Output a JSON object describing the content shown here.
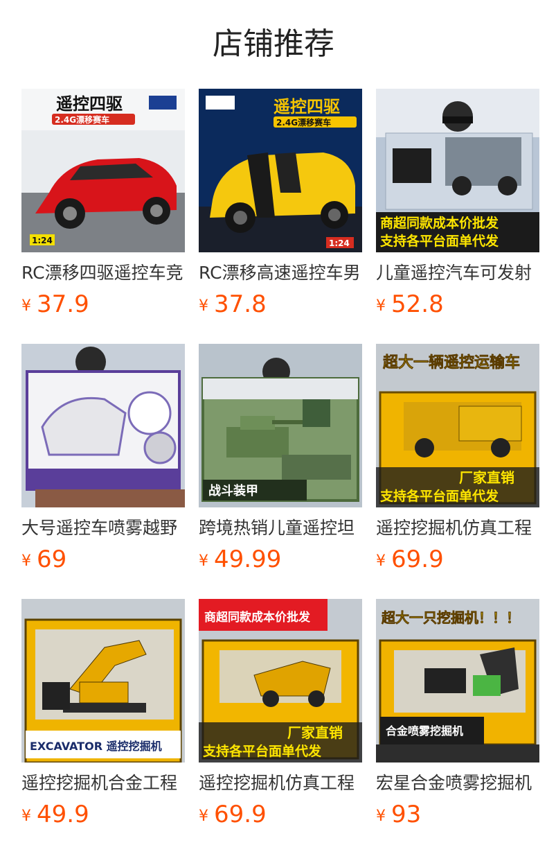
{
  "section": {
    "title": "店铺推荐"
  },
  "colors": {
    "price": "#ff5000",
    "title_text": "#333333",
    "heading": "#222222"
  },
  "products": [
    {
      "title": "RC漂移四驱遥控车竞",
      "currency": "¥",
      "price": "37.9",
      "image": {
        "icon": "red-sports-car-image",
        "banner": "遥控四驱",
        "sub_banner": "2.4G漂移赛车",
        "scale": "1:24"
      }
    },
    {
      "title": "RC漂移高速遥控车男",
      "currency": "¥",
      "price": "37.8",
      "image": {
        "icon": "yellow-muscle-car-image",
        "banner": "遥控四驱",
        "sub_banner": "2.4G漂移赛车",
        "scale": "1:24"
      }
    },
    {
      "title": "儿童遥控汽车可发射",
      "currency": "¥",
      "price": "52.8",
      "image": {
        "icon": "offroad-truck-box-image",
        "caption_line1": "商超同款成本价批发",
        "caption_line2": "支持各平台面单代发"
      }
    },
    {
      "title": "大号遥控车喷雾越野",
      "currency": "¥",
      "price": "69",
      "image": {
        "icon": "spray-offroad-car-box-image"
      }
    },
    {
      "title": "跨境热销儿童遥控坦",
      "currency": "¥",
      "price": "49.99",
      "image": {
        "icon": "rc-tank-box-image",
        "caption_line1": "战斗装甲"
      }
    },
    {
      "title": "遥控挖掘机仿真工程",
      "currency": "¥",
      "price": "69.9",
      "image": {
        "icon": "transport-truck-box-image",
        "banner": "超大一辆遥控运输车",
        "caption_line1": "厂家直销",
        "caption_line2": "支持各平台面单代发"
      }
    },
    {
      "title": "遥控挖掘机合金工程",
      "currency": "¥",
      "price": "49.9",
      "image": {
        "icon": "excavator-box-image",
        "caption_line1": "EXCAVATOR 遥控挖掘机"
      }
    },
    {
      "title": "遥控挖掘机仿真工程",
      "currency": "¥",
      "price": "69.9",
      "image": {
        "icon": "mining-truck-box-image",
        "banner": "商超同款成本价批发",
        "caption_line1": "厂家直销",
        "caption_line2": "支持各平台面单代发"
      }
    },
    {
      "title": "宏星合金喷雾挖掘机",
      "currency": "¥",
      "price": "93",
      "image": {
        "icon": "spray-excavator-box-image",
        "banner": "超大一只挖掘机！！！",
        "caption_line1": "合金喷雾挖掘机"
      }
    }
  ]
}
